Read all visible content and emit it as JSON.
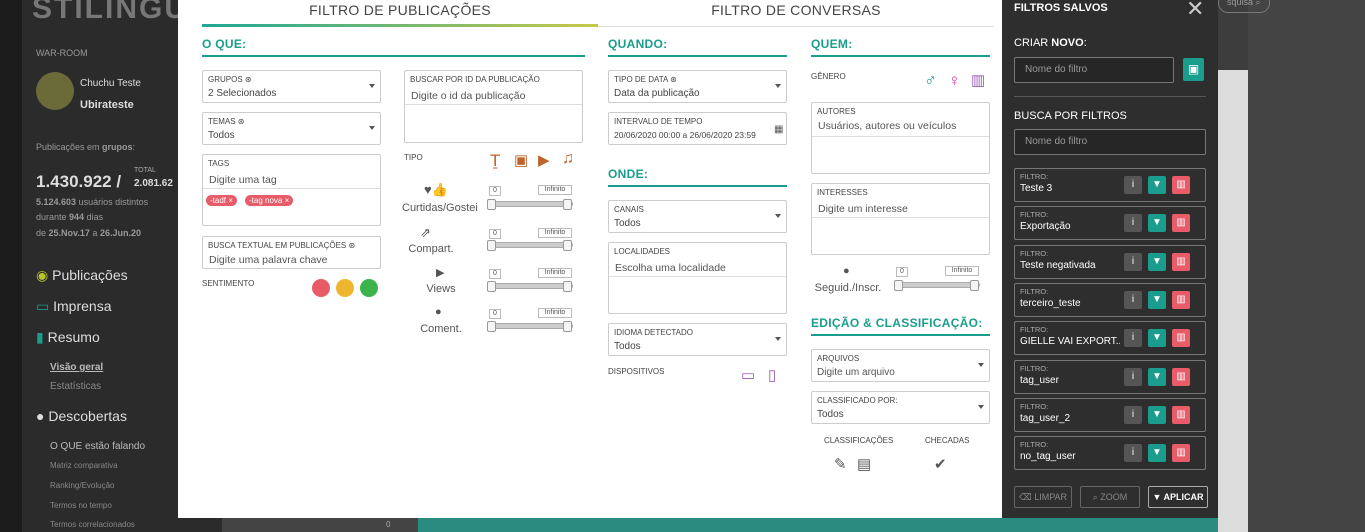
{
  "bg": {
    "logo": "STILINGU",
    "war_room": "WAR-ROOM",
    "user_name": "Chuchu Teste",
    "user_company": "Ubirateste",
    "pubs_label_pre": "Publicações em ",
    "pubs_label_bold": "grupos",
    "pubs_label_post": ":",
    "big_number": "1.430.922",
    "total_label": "TOTAL",
    "total_value": "2.081.62",
    "users_count": "5.124.603",
    "users_label": "usuários distintos",
    "during_label": "durante",
    "days_count": "944",
    "days_label": "dias",
    "date_from_label": "de",
    "date_from": "25.Nov.17",
    "date_to_label": "a",
    "date_to": "26.Jun.20",
    "menu": [
      "Publicações",
      "Imprensa",
      "Resumo"
    ],
    "sub_resumo": [
      "Visão geral",
      "Estatísticas"
    ],
    "descobertas": "Descobertas",
    "sub_descobertas_head": "O QUE estão falando",
    "sub_descobertas": [
      "Matriz comparativa",
      "Ranking/Evolução",
      "Termos no tempo",
      "Termos correlacionados"
    ],
    "top_search": "squisa",
    "axis_zero": "0"
  },
  "tabs": [
    "FILTRO DE PUBLICAÇÕES",
    "FILTRO DE CONVERSAS"
  ],
  "oque": {
    "title": "O QUE:",
    "grupos_label": "GRUPOS ⊛",
    "grupos_value": "2 Selecionados",
    "temas_label": "TEMAS ⊛",
    "temas_value": "Todos",
    "tags_label": "TAGS",
    "tags_placeholder": "Digite uma tag",
    "tags": [
      "-tadf",
      "-tag nova"
    ],
    "busca_label": "BUSCA TEXTUAL EM PUBLICAÇÕES ⊛",
    "busca_placeholder": "Digite uma palavra chave",
    "sentimento_label": "SENTIMENTO",
    "id_label": "BUSCAR POR ID DA PUBLICAÇÃO",
    "id_placeholder": "Digite o id da publicação",
    "tipo_label": "TIPO",
    "metrics": [
      {
        "label": "Curtidas/Gostei",
        "min": "0",
        "max": "Infinito"
      },
      {
        "label": "Compart.",
        "min": "0",
        "max": "Infinito"
      },
      {
        "label": "Views",
        "min": "0",
        "max": "Infinito"
      },
      {
        "label": "Coment.",
        "min": "0",
        "max": "Infinito"
      }
    ]
  },
  "quando": {
    "title": "QUANDO:",
    "tipo_data_label": "TIPO DE DATA ⊛",
    "tipo_data_value": "Data da publicação",
    "intervalo_label": "INTERVALO DE TEMPO",
    "intervalo_value": "20/06/2020 00:00 a 26/06/2020 23:59"
  },
  "onde": {
    "title": "ONDE:",
    "canais_label": "CANAIS",
    "canais_value": "Todos",
    "localidades_label": "LOCALIDADES",
    "localidades_placeholder": "Escolha uma localidade",
    "idioma_label": "IDIOMA DETECTADO",
    "idioma_value": "Todos",
    "dispositivos_label": "DISPOSITIVOS"
  },
  "quem": {
    "title": "QUEM:",
    "genero_label": "GÊNERO",
    "autores_label": "AUTORES",
    "autores_placeholder": "Usuários, autores ou veículos",
    "interesses_label": "INTERESSES",
    "interesses_placeholder": "Digite um interesse",
    "seguid_label": "Seguid./Inscr.",
    "seguid_min": "0",
    "seguid_max": "Infinito"
  },
  "edicao": {
    "title": "EDIÇÃO & CLASSIFICAÇÃO:",
    "arquivos_label": "ARQUIVOS",
    "arquivos_placeholder": "Digite um arquivo",
    "classificado_label": "CLASSIFICADO POR:",
    "classificado_value": "Todos",
    "classificacoes_label": "CLASSIFICAÇÕES",
    "checadas_label": "CHECADAS"
  },
  "saved": {
    "title_pre": "FILTROS ",
    "title_bold": "SALVOS",
    "criar_pre": "CRIAR ",
    "criar_bold": "NOVO",
    "criar_post": ":",
    "nome_placeholder": "Nome do filtro",
    "busca_label": "BUSCA POR FILTROS",
    "busca_placeholder": "Nome do filtro",
    "filter_label": "FILTRO:",
    "filters": [
      "Teste 3",
      "Exportação",
      "Teste negativada",
      "terceiro_teste",
      "GIELLE VAI EXPORT...",
      "tag_user",
      "tag_user_2",
      "no_tag_user"
    ],
    "limpar": "LIMPAR",
    "zoom": "ZOOM",
    "aplicar": "APLICAR"
  },
  "colors": {
    "accent": "#1a9d8c",
    "danger": "#e85c6a",
    "purple": "#9b59b6"
  }
}
